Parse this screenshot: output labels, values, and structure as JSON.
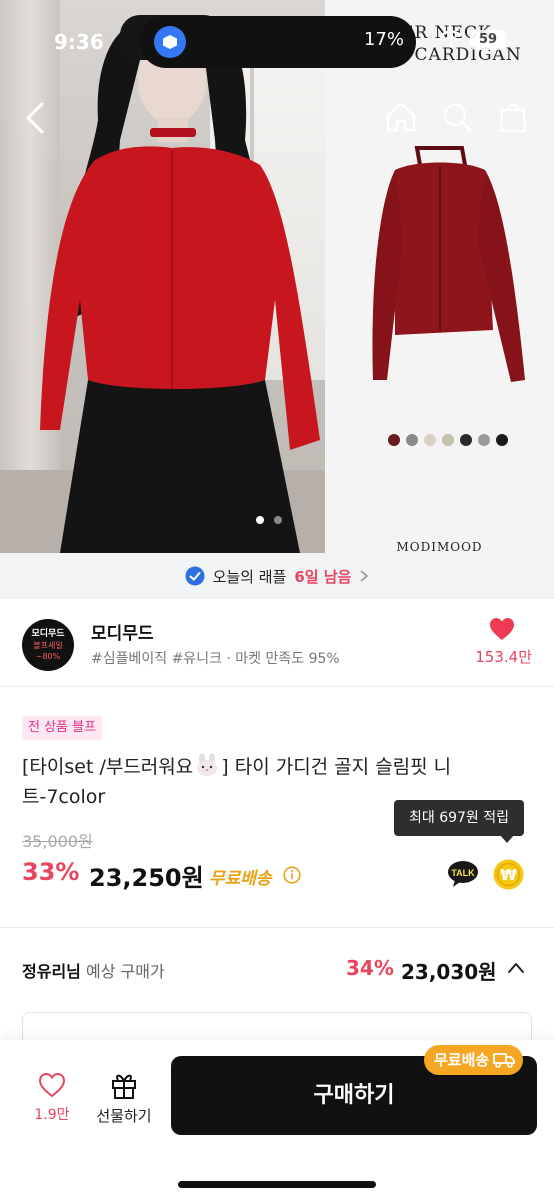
{
  "status_bar": {
    "time": "9:36",
    "battery_pct": "17%",
    "battery_level": "59"
  },
  "hero": {
    "right_title": "KER NECK\nRIBN CARDIGAN",
    "right_brand": "MODIMOOD",
    "swatches": [
      "#6b1a1e",
      "#8a8a8a",
      "#d9d2c5",
      "#c7c2ae",
      "#2b2b2b",
      "#9a9a9a",
      "#1a1a1a"
    ],
    "page_count": 2,
    "active_page": 1
  },
  "raffle": {
    "label": "오늘의 래플",
    "highlight": "6일 남음"
  },
  "shop": {
    "logo_line1": "모디무드",
    "logo_line2": "블프세일",
    "logo_line3": "~80%",
    "name": "모디무드",
    "tags": "#심플베이직 #유니크 · 마켓 만족도 95%",
    "like_count": "153.4만"
  },
  "product": {
    "badge": "전 상품 블프",
    "title_part1": "[타이set  /부드러워요",
    "title_part2": "]  타이 가디건 골지 슬림핏 니트-7color",
    "original_price": "35,000원",
    "discount": "33%",
    "price": "23,250원",
    "free_shipping": "무료배송",
    "points_tooltip": "최대 697원 적립",
    "talk_label": "TALK",
    "coin_symbol": "₩"
  },
  "expected": {
    "user": "정유리님",
    "label": " 예상 구매가",
    "discount": "34%",
    "price": "23,030원"
  },
  "bottom_bar": {
    "wish_count": "1.9만",
    "gift_label": "선물하기",
    "buy_label": "구매하기",
    "ship_chip": "무료배송"
  },
  "colors": {
    "accent_red": "#e8455f",
    "shipping_orange": "#f5a623",
    "tag_pink": "#e0338a"
  }
}
